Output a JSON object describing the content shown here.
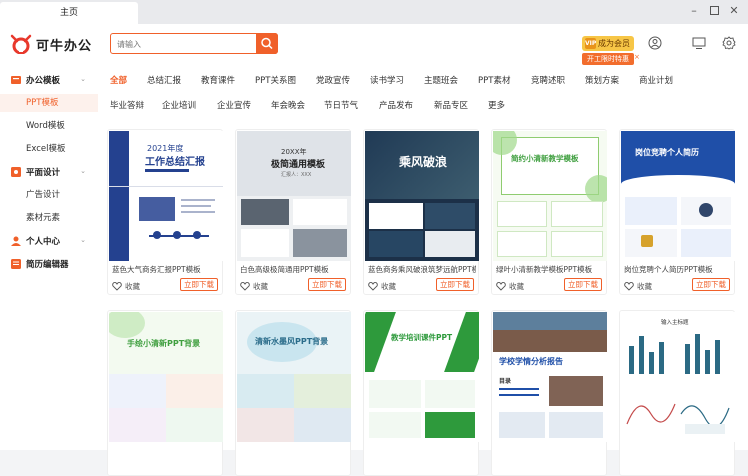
{
  "window": {
    "tab_title": "主页"
  },
  "header": {
    "logo_text": "可牛办公",
    "search_placeholder": "请输入",
    "vip_label": "成为会员",
    "vip_badge": "VIP",
    "promo_label": "开工限时特惠",
    "promo_close": "×"
  },
  "sidebar": {
    "groups": [
      {
        "label": "办公模板",
        "items": [
          "PPT模板",
          "Word模板",
          "Excel模板"
        ]
      },
      {
        "label": "平面设计",
        "items": [
          "广告设计",
          "素材元素"
        ]
      },
      {
        "label": "个人中心",
        "items": []
      },
      {
        "label": "简历编辑器",
        "items": []
      }
    ],
    "active_item": "PPT模板"
  },
  "categories": {
    "row1": [
      "全部",
      "总结汇报",
      "教育课件",
      "PPT关系图",
      "党政宣传",
      "读书学习",
      "主题班会",
      "PPT素材",
      "竞聘述职",
      "策划方案",
      "商业计划"
    ],
    "row2": [
      "毕业答辩",
      "企业培训",
      "企业宣传",
      "年会晚会",
      "节日节气",
      "产品发布",
      "新品专区",
      "更多"
    ],
    "active": "全部"
  },
  "cards": [
    {
      "title": "蓝色大气商务汇报PPT模板",
      "thumb_heading": "2021年度",
      "thumb_sub": "工作总结汇报"
    },
    {
      "title": "白色高级极简通用PPT模板",
      "thumb_heading": "20XX年",
      "thumb_sub": "极简通用模板",
      "thumb_note": "汇报人：XXX"
    },
    {
      "title": "蓝色商务乘风破浪筑梦远航PPT模...",
      "thumb_heading": "乘风破浪"
    },
    {
      "title": "绿叶小清新教学模板PPT模板",
      "thumb_heading": "简约小清新教学模板"
    },
    {
      "title": "岗位竞聘个人简历PPT模板",
      "thumb_heading": "岗位竞聘个人简历"
    },
    {
      "title": "",
      "thumb_heading": "手绘小清新PPT背景"
    },
    {
      "title": "",
      "thumb_heading": "清新水墨风PPT背景"
    },
    {
      "title": "",
      "thumb_heading": "教学培训课件PPT"
    },
    {
      "title": "",
      "thumb_heading": "学校学情分析报告",
      "thumb_note": "目录"
    },
    {
      "title": "",
      "thumb_heading": "输入主标题"
    }
  ],
  "card_actions": {
    "favorite": "收藏",
    "download": "立即下载"
  },
  "colors": {
    "accent": "#f0602a",
    "navy": "#24418f",
    "green": "#3f9f3f"
  }
}
